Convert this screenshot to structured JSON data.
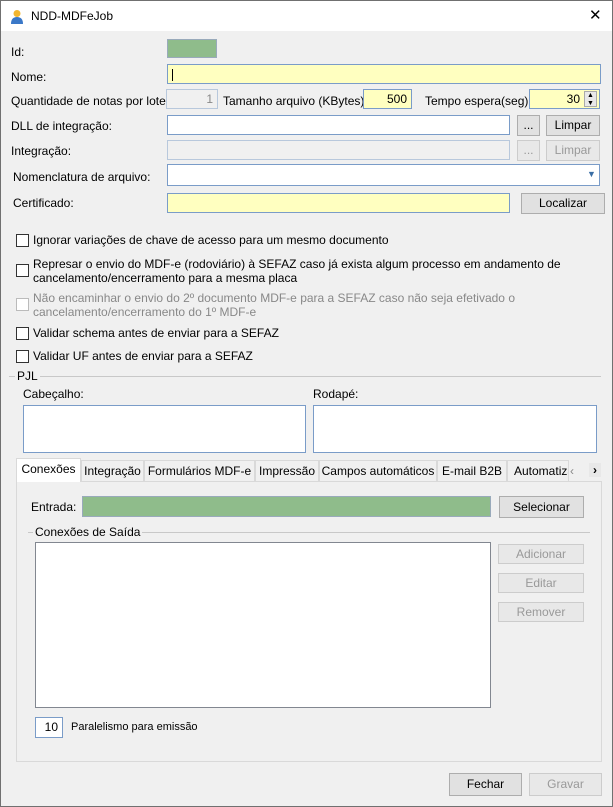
{
  "window": {
    "title": "NDD-MDFeJob",
    "close": "✕"
  },
  "form": {
    "id_label": "Id:",
    "nome_label": "Nome:",
    "nome_value": "",
    "qtd_label": "Quantidade de notas por lote:",
    "qtd_value": "1",
    "tamanho_label": "Tamanho arquivo (KBytes):",
    "tamanho_value": "500",
    "tempo_label": "Tempo espera(seg):",
    "tempo_value": "30",
    "dll_label": "DLL de integração:",
    "integracao_label": "Integração:",
    "browse": "...",
    "limpar": "Limpar",
    "nomenclatura_label": "Nomenclatura de arquivo:",
    "certificado_label": "Certificado:",
    "localizar": "Localizar"
  },
  "checkboxes": [
    "Ignorar variações de chave de acesso para um mesmo documento",
    "Represar o envio do MDF-e (rodoviário) à SEFAZ caso já exista algum processo em andamento de cancelamento/encerramento para a mesma placa",
    "Não encaminhar o envio do 2º documento MDF-e para a SEFAZ caso não seja efetivado o cancelamento/encerramento do 1º MDF-e",
    "Validar schema antes de enviar para a SEFAZ",
    "Validar UF antes de enviar para a SEFAZ"
  ],
  "pjl": {
    "title": "PJL",
    "cabecalho": "Cabeçalho:",
    "rodape": "Rodapé:"
  },
  "tabs": [
    "Conexões",
    "Integração",
    "Formulários MDF-e",
    "Impressão",
    "Campos automáticos",
    "E-mail B2B",
    "Automatiza"
  ],
  "conexoes": {
    "entrada_label": "Entrada:",
    "selecionar": "Selecionar",
    "saida_title": "Conexões de Saída",
    "adicionar": "Adicionar",
    "editar": "Editar",
    "remover": "Remover",
    "paralelismo_value": "10",
    "paralelismo_label": "Paralelismo para emissão"
  },
  "footer": {
    "fechar": "Fechar",
    "gravar": "Gravar"
  }
}
